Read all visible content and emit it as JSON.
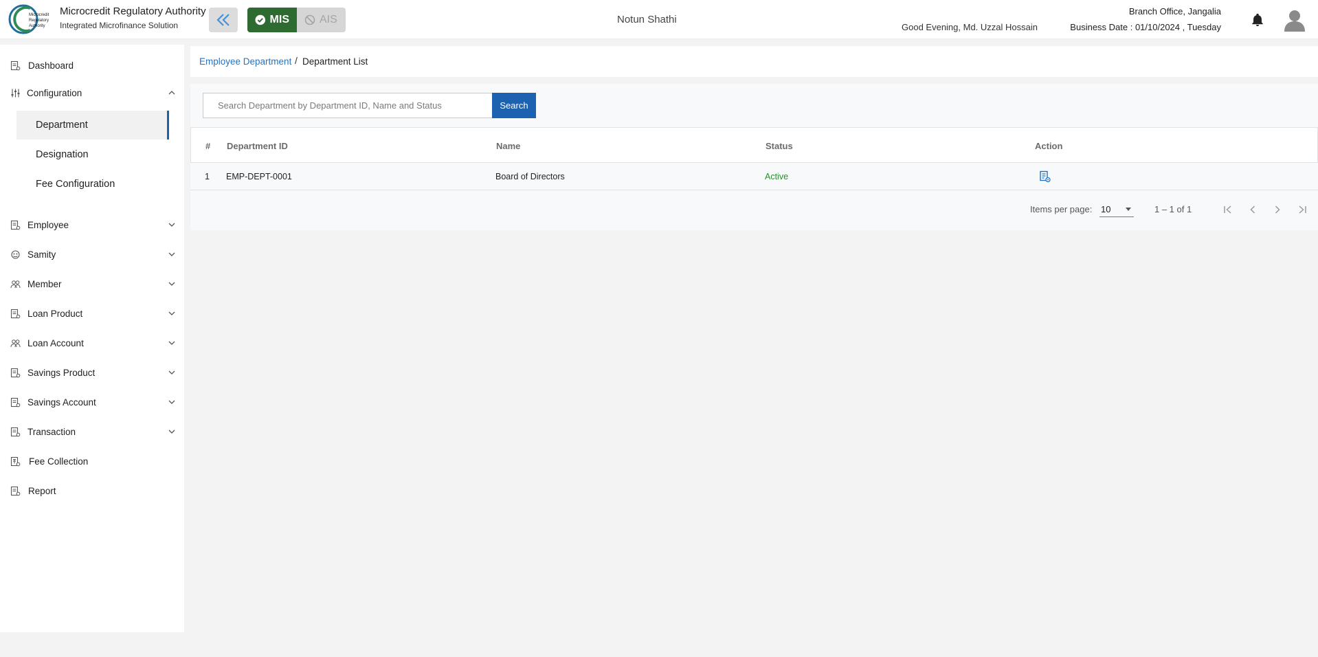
{
  "header": {
    "logo_text": "Microcredit Regulatory Authority",
    "org_name": "Microcredit Regulatory Authority",
    "org_subtitle": "Integrated Microfinance Solution",
    "mode_active": "MIS",
    "mode_inactive": "AIS",
    "app_title": "Notun Shathi",
    "greeting": "Good Evening, Md. Uzzal Hossain",
    "branch": "Branch Office, Jangalia",
    "business_date": "Business Date : 01/10/2024 , Tuesday"
  },
  "sidebar": {
    "items": [
      {
        "label": "Dashboard",
        "icon": "dashboard-icon"
      },
      {
        "label": "Configuration",
        "icon": "sliders-icon",
        "expanded": true
      },
      {
        "label": "Employee",
        "icon": "employee-icon"
      },
      {
        "label": "Samity",
        "icon": "samity-icon"
      },
      {
        "label": "Member",
        "icon": "member-icon"
      },
      {
        "label": "Loan Product",
        "icon": "loan-product-icon"
      },
      {
        "label": "Loan Account",
        "icon": "loan-account-icon"
      },
      {
        "label": "Savings Product",
        "icon": "savings-product-icon"
      },
      {
        "label": "Savings Account",
        "icon": "savings-account-icon"
      },
      {
        "label": "Transaction",
        "icon": "transaction-icon"
      },
      {
        "label": "Fee Collection",
        "icon": "fee-collection-icon"
      },
      {
        "label": "Report",
        "icon": "report-icon"
      }
    ],
    "config_sub": [
      {
        "label": "Department",
        "active": true
      },
      {
        "label": "Designation"
      },
      {
        "label": "Fee Configuration"
      }
    ]
  },
  "breadcrumb": {
    "parent": "Employee Department",
    "separator": "/",
    "current": "Department List"
  },
  "search": {
    "placeholder": "Search Department by Department ID, Name and Status",
    "button": "Search"
  },
  "table": {
    "columns": [
      "#",
      "Department ID",
      "Name",
      "Status",
      "Action"
    ],
    "rows": [
      {
        "index": "1",
        "department_id": "EMP-DEPT-0001",
        "name": "Board of Directors",
        "status": "Active"
      }
    ]
  },
  "paginator": {
    "items_per_page_label": "Items per page:",
    "items_per_page": "10",
    "range": "1 – 1 of 1"
  },
  "colors": {
    "primary": "#1c62b0",
    "link": "#1f73c8",
    "mis_active": "#2e6b31",
    "status_active": "#2e8b2e"
  }
}
